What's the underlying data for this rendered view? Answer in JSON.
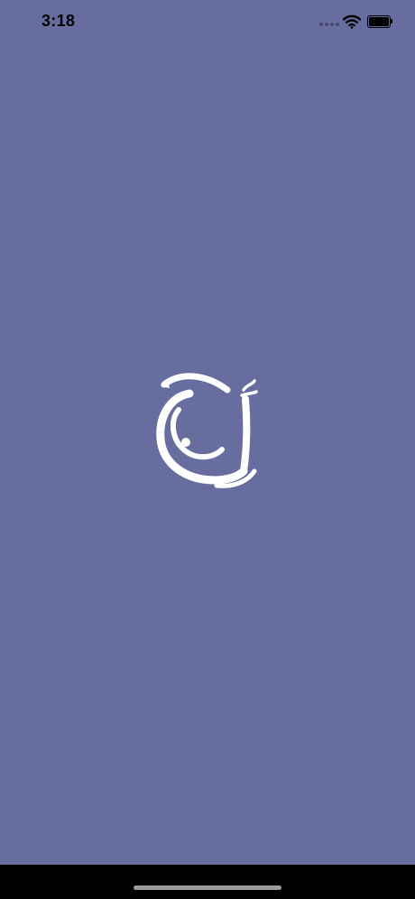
{
  "status_bar": {
    "time": "3:18",
    "icons": [
      "signal-dots-icon",
      "wifi-icon",
      "battery-icon"
    ],
    "battery_level": 1.0
  },
  "splash": {
    "logo": "calligraphy-logo-icon",
    "background_color": "#676e9f",
    "logo_color": "#ffffff"
  },
  "home_indicator": {
    "bar_color": "#9a9a9a",
    "area_color": "#000000"
  }
}
